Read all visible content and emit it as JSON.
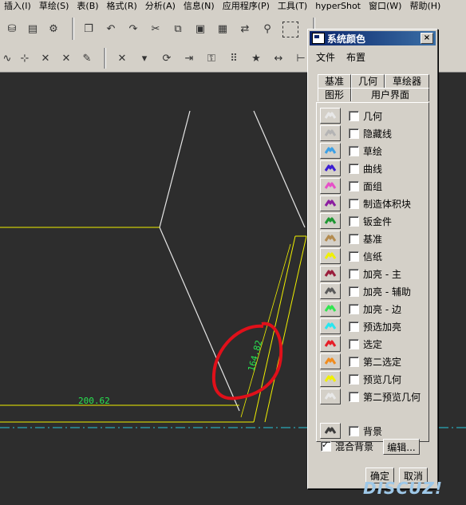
{
  "menubar": {
    "items": [
      "插入(I)",
      "草绘(S)",
      "表(B)",
      "格式(R)",
      "分析(A)",
      "信息(N)",
      "应用程序(P)",
      "工具(T)",
      "hyperShot",
      "窗口(W)",
      "帮助(H)"
    ]
  },
  "canvas": {
    "dim_horizontal": "200.62",
    "dim_vertical": "164.82"
  },
  "dialog": {
    "title": "系统颜色",
    "close": "×",
    "menu": [
      "文件",
      "布置"
    ],
    "tabs_row1": [
      "基准",
      "几何",
      "草绘器"
    ],
    "tabs_row2": [
      "图形",
      "用户界面"
    ],
    "rows": [
      {
        "label": "几何",
        "color": "#e8e8e8",
        "checked": false
      },
      {
        "label": "隐藏线",
        "color": "#b4b4b4",
        "checked": false
      },
      {
        "label": "草绘",
        "color": "#3ca0e6",
        "checked": false
      },
      {
        "label": "曲线",
        "color": "#3c1ed2",
        "checked": false
      },
      {
        "label": "面组",
        "color": "#e650c8",
        "checked": false
      },
      {
        "label": "制造体积块",
        "color": "#8c1ea0",
        "checked": false
      },
      {
        "label": "钣金件",
        "color": "#1e9632",
        "checked": false
      },
      {
        "label": "基准",
        "color": "#b48c50",
        "checked": false
      },
      {
        "label": "信纸",
        "color": "#f0f000",
        "checked": false
      },
      {
        "label": "加亮 - 主",
        "color": "#9a1e3c",
        "checked": false
      },
      {
        "label": "加亮 - 辅助",
        "color": "#5a5a5a",
        "checked": false
      },
      {
        "label": "加亮 - 边",
        "color": "#32e650",
        "checked": false
      },
      {
        "label": "预选加亮",
        "color": "#28e6f0",
        "checked": false
      },
      {
        "label": "选定",
        "color": "#e61e28",
        "checked": false
      },
      {
        "label": "第二选定",
        "color": "#f08c1e",
        "checked": false
      },
      {
        "label": "预览几何",
        "color": "#f0f000",
        "checked": false
      },
      {
        "label": "第二预览几何",
        "color": "#e8e8e8",
        "checked": false
      }
    ],
    "background_row": {
      "label": "背景",
      "color": "#3c3c3c",
      "checked": false
    },
    "blend": {
      "label": "混合背景",
      "checked": true
    },
    "edit_button": "编辑...",
    "ok_button": "确定",
    "cancel_button": "取消"
  },
  "watermark": "DISCUZ!"
}
